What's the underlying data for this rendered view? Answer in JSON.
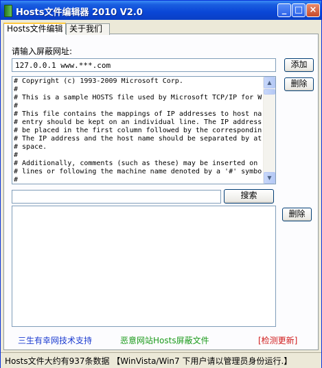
{
  "window": {
    "title": "Hosts文件编辑器 2010 V2.0",
    "minimize": "_",
    "maximize": "□",
    "close": "×"
  },
  "tabs": [
    {
      "label": "Hosts文件编辑"
    },
    {
      "label": "关于我们"
    }
  ],
  "form": {
    "url_label": "请输入屏蔽网址:",
    "url_value": "127.0.0.1 www.***.com",
    "add_button": "添加",
    "delete_button": "删除",
    "search_value": "",
    "search_button": "搜索",
    "delete_button2": "删除"
  },
  "hosts_lines": [
    "# Copyright (c) 1993-2009 Microsoft Corp.",
    "#",
    "# This is a sample HOSTS file used by Microsoft TCP/IP for W",
    "#",
    "# This file contains the mappings of IP addresses to host na",
    "# entry should be kept on an individual line. The IP address",
    "# be placed in the first column followed by the correspondin",
    "# The IP address and the host name should be separated by at",
    "# space.",
    "#",
    "# Additionally, comments (such as these) may be inserted on",
    "# lines or following the machine name denoted by a '#' symbo",
    "#"
  ],
  "links": {
    "support": "三生有幸网技术支持",
    "malicious": "恶意网站Hosts屏蔽文件",
    "update": "[检测更新]"
  },
  "status": {
    "text": "Hosts文件大约有937条数据 【WinVista/Win7 下用户请以管理员身份运行.】"
  },
  "colors": {
    "title_bar": "#0a46d6",
    "link_blue": "#1a3ad0",
    "link_green": "#1a9a1a",
    "link_red": "#d01a1a"
  }
}
